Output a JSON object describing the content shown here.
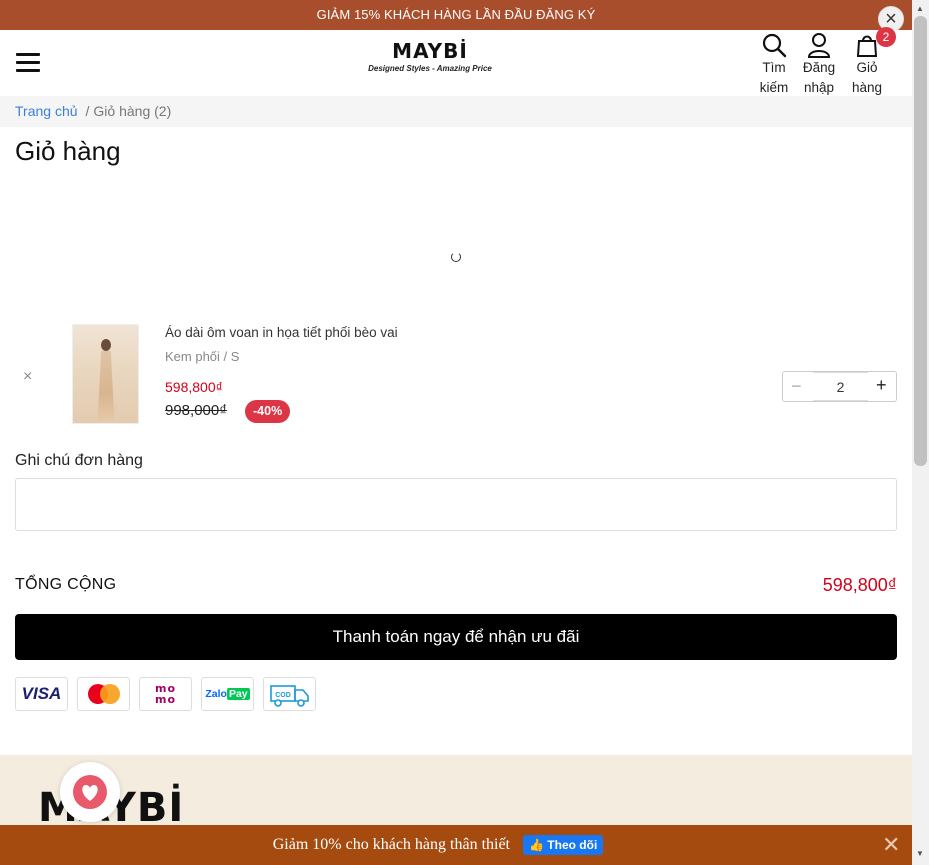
{
  "promo_bar": {
    "text": "GIẢM 15% KHÁCH HÀNG LẦN ĐẦU ĐĂNG KÝ",
    "close_icon": "×"
  },
  "header": {
    "logo": "MAYBİ",
    "tagline": "Designed Styles - Amazing Price",
    "actions": {
      "search_line1": "Tìm",
      "search_line2": "kiếm",
      "login_line1": "Đăng",
      "login_line2": "nhập",
      "cart_line1": "Giỏ",
      "cart_line2": "hàng",
      "cart_count": "2"
    }
  },
  "breadcrumb": {
    "home": "Trang chủ",
    "separator": "/",
    "current": "Giỏ hàng (2)"
  },
  "page_title": "Giỏ hàng",
  "cart_item": {
    "remove_icon": "×",
    "name": "Áo dài ôm voan in họa tiết phối bèo vai",
    "variant": "Kem phối / S",
    "price": "598,800₫",
    "old_price": "998,000₫",
    "discount": "-40%",
    "quantity": "2",
    "minus": "−",
    "plus": "+"
  },
  "note": {
    "label": "Ghi chú đơn hàng",
    "placeholder": ""
  },
  "total": {
    "label": "TỔNG CỘNG",
    "value": "598,800₫"
  },
  "checkout_label": "Thanh toán ngay để nhận ưu đãi",
  "payments": {
    "visa": "VISA",
    "momo_line1": "mo",
    "momo_line2": "mo",
    "zalo_prefix": "Zalo",
    "zalo_suffix": "Pay",
    "cod": "COD"
  },
  "footer": {
    "logo": "MAYBİ"
  },
  "bottom_bar": {
    "text": "Giảm 10% cho khách hàng thân thiết",
    "follow_label": "Theo dõi",
    "close_icon": "✕"
  },
  "colors": {
    "promo": "#a94e2d",
    "accent_red": "#d0021b",
    "badge": "#dc3545",
    "bottom_bar": "#a54b0f",
    "footer_bg": "#f5ece0"
  }
}
